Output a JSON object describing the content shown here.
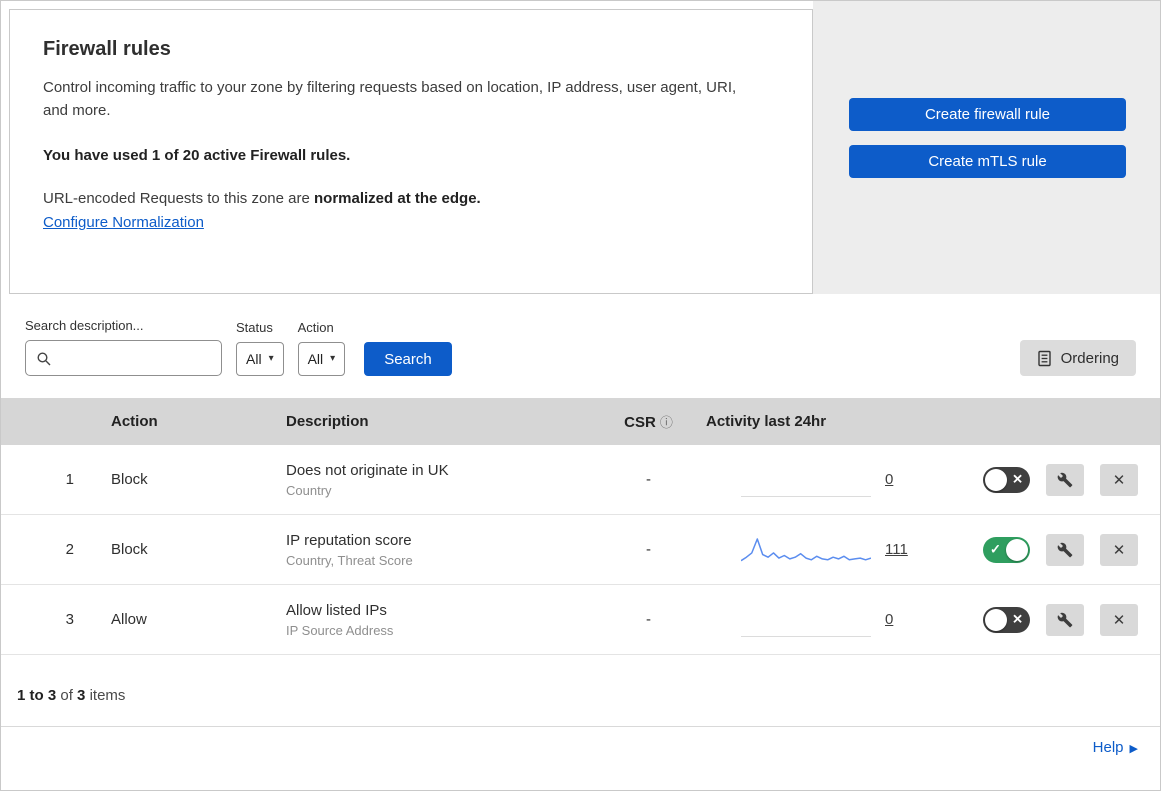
{
  "colors": {
    "primary": "#0d5cc9",
    "toggle_on": "#2f9e5f",
    "toggle_off": "#3f3f3f",
    "sparkline": "#5b8def",
    "panel_bg": "#ededed",
    "table_header_bg": "#d6d6d6"
  },
  "header": {
    "title": "Firewall rules",
    "description": "Control incoming traffic to your zone by filtering requests based on location, IP address, user agent, URI, and more.",
    "usage": "You have used 1 of 20 active Firewall rules.",
    "normalization_prefix": "URL-encoded Requests to this zone are ",
    "normalization_bold": "normalized at the edge.",
    "normalization_link": "Configure Normalization"
  },
  "actions": {
    "create_firewall_rule": "Create firewall rule",
    "create_mtls_rule": "Create mTLS rule"
  },
  "toolbar": {
    "search_label": "Search description...",
    "status_label": "Status",
    "status_value": "All",
    "action_label": "Action",
    "action_value": "All",
    "search_button": "Search",
    "ordering_button": "Ordering"
  },
  "table": {
    "columns": {
      "action": "Action",
      "description": "Description",
      "csr": "CSR",
      "activity": "Activity last 24hr"
    },
    "rows": [
      {
        "index": "1",
        "action": "Block",
        "description": "Does not originate in UK",
        "criteria": "Country",
        "csr": "-",
        "activity": "0",
        "enabled": false
      },
      {
        "index": "2",
        "action": "Block",
        "description": "IP reputation score",
        "criteria": "Country, Threat Score",
        "csr": "-",
        "activity": "111",
        "enabled": true,
        "sparkline": [
          5,
          9,
          14,
          30,
          12,
          9,
          14,
          8,
          11,
          7,
          9,
          13,
          8,
          6,
          10,
          7,
          6,
          9,
          7,
          10,
          6,
          7,
          8,
          6,
          8
        ]
      },
      {
        "index": "3",
        "action": "Allow",
        "description": "Allow listed IPs",
        "criteria": "IP Source Address",
        "csr": "-",
        "activity": "0",
        "enabled": false
      }
    ]
  },
  "footer": {
    "range": "1 to 3",
    "of": "of",
    "total": "3",
    "items": "items"
  },
  "help": {
    "label": "Help"
  }
}
